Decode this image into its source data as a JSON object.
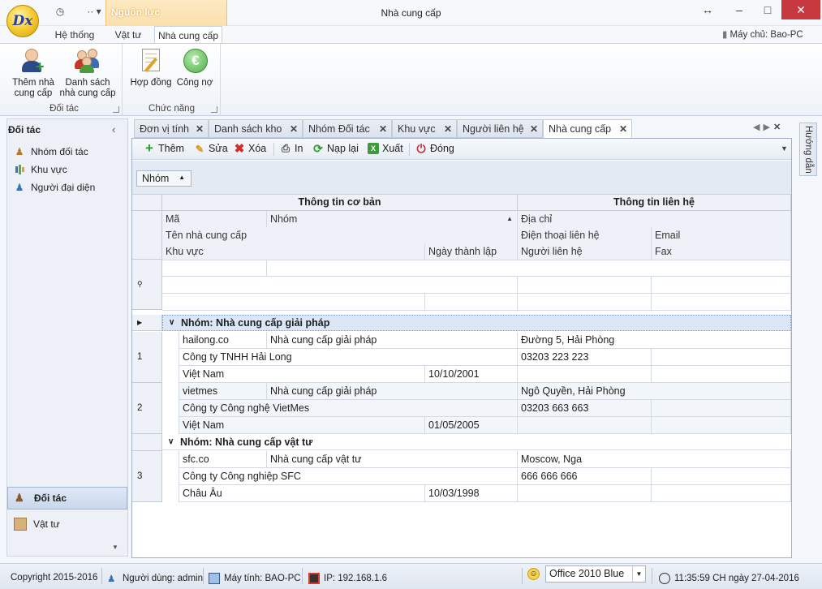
{
  "window": {
    "title": "Nhà cung cấp",
    "context_tab": "Nguồn lực",
    "logo_text": "Dx"
  },
  "ribbon": {
    "tabs": [
      {
        "label": "Hệ thống"
      },
      {
        "label": "Vật tư"
      },
      {
        "label": "Nhà cung cấp",
        "active": true
      }
    ],
    "server": "Máy chủ: Bao-PC",
    "groups": [
      {
        "label": "Đối tác",
        "buttons": [
          {
            "label_1": "Thêm nhà",
            "label_2": "cung cấp",
            "icon": "add-user-icon"
          },
          {
            "label_1": "Danh sách",
            "label_2": "nhà cung cấp",
            "icon": "users-group-icon"
          }
        ]
      },
      {
        "label": "Chức năng",
        "buttons": [
          {
            "label_1": "Hợp đồng",
            "icon": "contract-icon"
          },
          {
            "label_1": "Công nợ",
            "icon": "euro-coin-icon"
          }
        ]
      }
    ]
  },
  "sidebar": {
    "title": "Đối tác",
    "items": [
      {
        "label": "Nhóm đối tác"
      },
      {
        "label": "Khu vực"
      },
      {
        "label": "Người đại diện"
      }
    ],
    "panes": [
      {
        "label": "Đối tác",
        "active": true
      },
      {
        "label": "Vật tư"
      }
    ]
  },
  "doc_tabs": [
    {
      "label": "Đơn vị tính"
    },
    {
      "label": "Danh sách kho"
    },
    {
      "label": "Nhóm Đối tác"
    },
    {
      "label": "Khu vực"
    },
    {
      "label": "Người liên hệ"
    },
    {
      "label": "Nhà cung cấp",
      "active": true
    }
  ],
  "toolbar": {
    "add": "Thêm",
    "edit": "Sửa",
    "delete": "Xóa",
    "print": "In",
    "reload": "Nạp lại",
    "export": "Xuất",
    "close": "Đóng"
  },
  "group_panel": {
    "chip": "Nhóm"
  },
  "grid": {
    "bands": {
      "basic": "Thông tin cơ bản",
      "contact": "Thông tin liên hệ"
    },
    "columns": {
      "code": "Mã",
      "group": "Nhóm",
      "address": "Địa chỉ",
      "name": "Tên nhà cung cấp",
      "phone": "Điện thoại liên hệ",
      "email": "Email",
      "region": "Khu vực",
      "founded": "Ngày thành lập",
      "contact": "Người liên hệ",
      "fax": "Fax"
    },
    "groups": [
      {
        "label": "Nhóm: Nhà cung cấp giải pháp"
      },
      {
        "label": "Nhóm: Nhà cung cấp vật tư"
      }
    ],
    "rows": [
      {
        "no": "1",
        "code": "hailong.co",
        "group": "Nhà cung cấp giải pháp",
        "address": "Đường 5, Hải Phòng",
        "name": "Công ty TNHH Hải Long",
        "phone": "03203 223 223",
        "region": "Việt Nam",
        "founded": "10/10/2001"
      },
      {
        "no": "2",
        "code": "vietmes",
        "group": "Nhà cung cấp giải pháp",
        "address": "Ngô Quyền, Hải Phòng",
        "name": "Công ty Công nghệ VietMes",
        "phone": "03203 663 663",
        "region": "Việt Nam",
        "founded": "01/05/2005"
      },
      {
        "no": "3",
        "code": "sfc.co",
        "group": "Nhà cung cấp vật tư",
        "address": "Moscow, Nga",
        "name": "Công ty Công nghiệp SFC",
        "phone": "666 666 666",
        "region": "Châu Âu",
        "founded": "10/03/1998"
      }
    ]
  },
  "guide_tab": "Hướng dẫn",
  "statusbar": {
    "copyright": "Copyright 2015-2016",
    "user": "Người dùng: admin",
    "computer": "Máy tính: BAO-PC",
    "ip": "IP: 192.168.1.6",
    "theme": "Office 2010 Blue",
    "datetime": "11:35:59 CH ngày 27-04-2016"
  }
}
